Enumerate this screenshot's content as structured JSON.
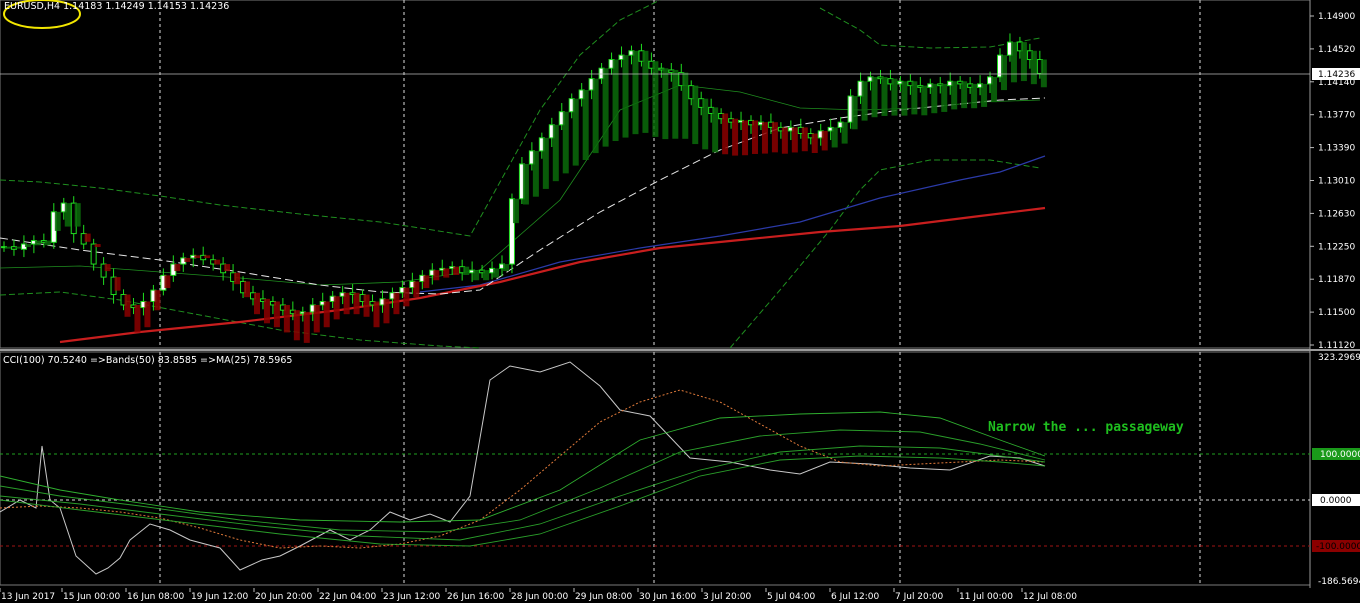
{
  "main_chart": {
    "symbol_legend": "EURUSD,H4  1.14183 1.14249 1.14153 1.14236",
    "price_axis_labels": [
      "1.14900",
      "1.14520",
      "1.14140",
      "1.13770",
      "1.13390",
      "1.13010",
      "1.12630",
      "1.12250",
      "1.11870",
      "1.11500",
      "1.11120"
    ],
    "current_price": "1.14236",
    "y_range": [
      1.1112,
      1.149
    ]
  },
  "indicator": {
    "legend": "CCI(100) 70.5240  =>Bands(50) 83.8585  =>MA(25) 78.5965",
    "axis_top": "323.2969",
    "axis_bottom": "-186.5694",
    "level_plus": "100.0000",
    "level_zero": "0.0000",
    "level_minus": "-100.0000",
    "annotation": "Narrow the ... passageway",
    "y_range": [
      -186.5694,
      323.2969
    ]
  },
  "time_labels": [
    "13 Jun 2017",
    "15 Jun 00:00",
    "16 Jun 08:00",
    "19 Jun 12:00",
    "20 Jun 20:00",
    "22 Jun 04:00",
    "23 Jun 12:00",
    "26 Jun 16:00",
    "28 Jun 00:00",
    "29 Jun 08:00",
    "30 Jun 16:00",
    "3 Jul 20:00",
    "5 Jul 04:00",
    "6 Jul 12:00",
    "7 Jul 20:00",
    "11 Jul 00:00",
    "12 Jul 08:00"
  ],
  "colors": {
    "bull_candle": "#1fdf1f",
    "bull_fill": "#0b6b0b",
    "bear_fill": "#8b0000",
    "ma_red": "#c81e1e",
    "ma_blue": "#2b3aa8",
    "dashed_white": "#e6e6e6",
    "band_green": "#1f8f1f",
    "legend_circle": "#f2e600"
  }
}
